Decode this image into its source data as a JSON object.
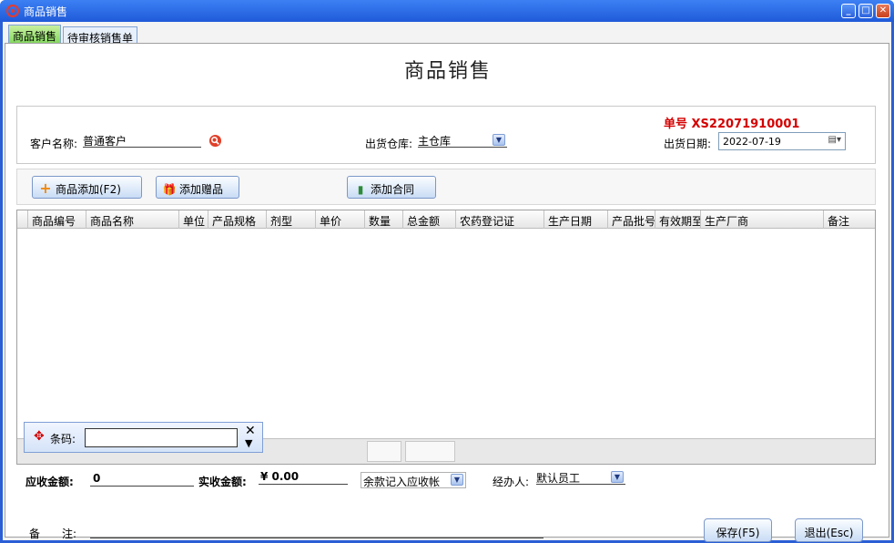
{
  "window": {
    "title": "商品销售"
  },
  "tabs": [
    {
      "label": "商品销售",
      "active": true
    },
    {
      "label": "待审核销售单",
      "active": false
    }
  ],
  "page": {
    "title": "商品销售"
  },
  "header": {
    "order_no": "单号  XS22071910001",
    "customer_label": "客户名称:",
    "customer_value": "普通客户",
    "warehouse_label": "出货仓库:",
    "warehouse_value": "主仓库",
    "date_label": "出货日期:",
    "date_value": "2022-07-19"
  },
  "toolbar": {
    "add_product": "商品添加(F2)",
    "add_gift": "添加赠品",
    "add_contract": "添加合同"
  },
  "grid": {
    "columns": [
      "商品编号",
      "商品名称",
      "单位",
      "产品规格",
      "剂型",
      "单价",
      "数量",
      "总金额",
      "农药登记证",
      "生产日期",
      "产品批号",
      "有效期至",
      "生产厂商",
      "备注"
    ]
  },
  "barcode": {
    "label": "条码:",
    "value": ""
  },
  "footer": {
    "receivable_label": "应收金额:",
    "receivable_value": "0",
    "received_label": "实收金额:",
    "received_value": "¥ 0.00",
    "balance_option": "余款记入应收帐",
    "operator_label": "经办人:",
    "operator_value": "默认员工",
    "remark_label_1": "备",
    "remark_label_2": "注:",
    "remark_value": "",
    "save": "保存(F5)",
    "exit": "退出(Esc)"
  },
  "colors": {
    "title_bar": "#1f5ad8",
    "order_no": "#d40000",
    "active_tab": "#7fd65a"
  }
}
